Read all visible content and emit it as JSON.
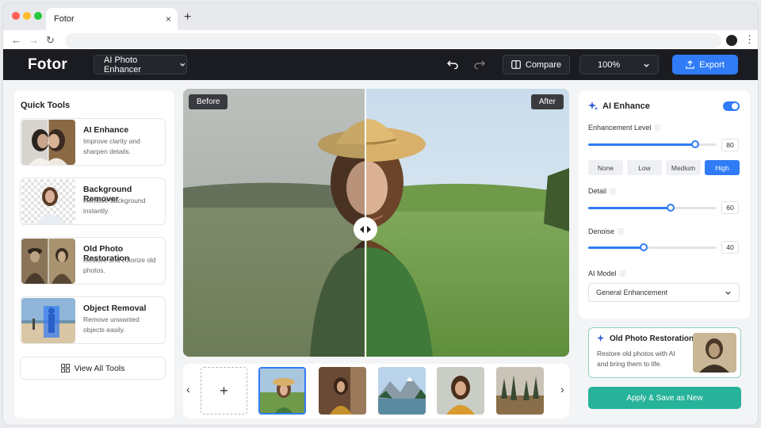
{
  "browser": {
    "tab_title": "Fotor",
    "tab_close": "×",
    "new_tab": "+",
    "back": "←",
    "forward": "→",
    "reload": "↻",
    "menu": "⋮"
  },
  "header": {
    "logo": "Fotor",
    "mode": "AI Photo Enhancer",
    "compare_label": "Compare",
    "zoom": "100%",
    "export_label": "Export"
  },
  "quick_tools": {
    "title": "Quick Tools",
    "items": [
      {
        "title": "AI Enhance",
        "desc": "Improve clarity and sharpen details."
      },
      {
        "title": "Background Remover",
        "desc": "Remove background instantly."
      },
      {
        "title": "Old Photo Restoration",
        "desc": "Restore and colorize old photos."
      },
      {
        "title": "Object Removal",
        "desc": "Remove unwanted objects easily."
      }
    ],
    "view_all": "View All Tools"
  },
  "viewer": {
    "before_label": "Before",
    "after_label": "After",
    "split_position": 0.47
  },
  "filmstrip": {
    "add_label": "+",
    "prev": "‹",
    "next": "›",
    "selected_index": 0,
    "count": 6
  },
  "ai_enhance": {
    "title": "AI Enhance",
    "enabled": true,
    "enhancement_label": "Enhancement Level",
    "enhancement_value": "80",
    "levels": [
      "None",
      "Low",
      "Medium",
      "High"
    ],
    "active_level": "High",
    "detail_label": "Detail",
    "detail_value": "60",
    "denoise_label": "Denoise",
    "denoise_value": "40",
    "model_label": "AI Model",
    "model_value": "General Enhancement"
  },
  "promo": {
    "title": "Old Photo Restoration",
    "desc": "Restore old photos with AI and bring them to life."
  },
  "apply_label": "Apply & Save as New",
  "colors": {
    "accent": "#2f7cf6",
    "header_bg": "#1a1c22",
    "apply": "#27b29a"
  }
}
